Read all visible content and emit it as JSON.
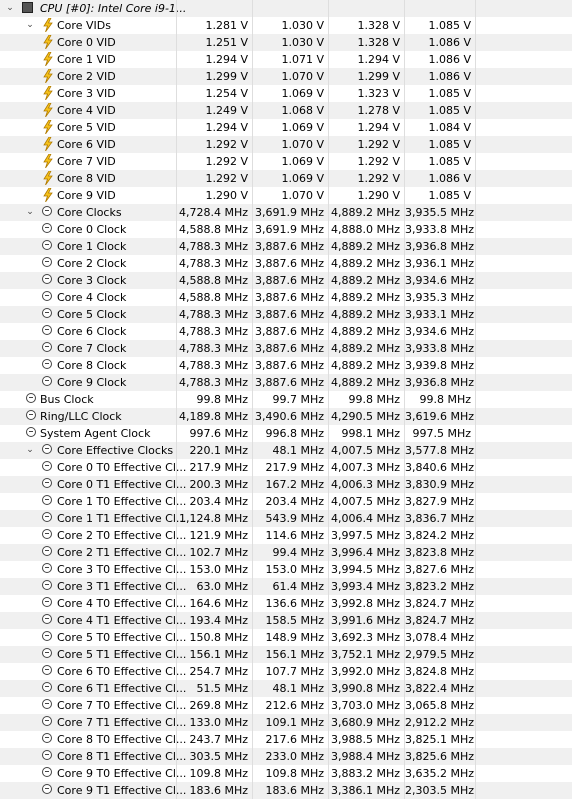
{
  "header": {
    "label": "CPU [#0]: Intel Core i9-1..."
  },
  "rows": [
    {
      "level": 1,
      "expander": "open",
      "icon": "bolt-icon",
      "label": "Core VIDs",
      "values": [
        "1.281 V",
        "1.030 V",
        "1.328 V",
        "1.085 V"
      ]
    },
    {
      "level": 2,
      "icon": "bolt-icon",
      "label": "Core 0 VID",
      "values": [
        "1.251 V",
        "1.030 V",
        "1.328 V",
        "1.086 V"
      ]
    },
    {
      "level": 2,
      "icon": "bolt-icon",
      "label": "Core 1 VID",
      "values": [
        "1.294 V",
        "1.071 V",
        "1.294 V",
        "1.086 V"
      ]
    },
    {
      "level": 2,
      "icon": "bolt-icon",
      "label": "Core 2 VID",
      "values": [
        "1.299 V",
        "1.070 V",
        "1.299 V",
        "1.086 V"
      ]
    },
    {
      "level": 2,
      "icon": "bolt-icon",
      "label": "Core 3 VID",
      "values": [
        "1.254 V",
        "1.069 V",
        "1.323 V",
        "1.085 V"
      ]
    },
    {
      "level": 2,
      "icon": "bolt-icon",
      "label": "Core 4 VID",
      "values": [
        "1.249 V",
        "1.068 V",
        "1.278 V",
        "1.085 V"
      ]
    },
    {
      "level": 2,
      "icon": "bolt-icon",
      "label": "Core 5 VID",
      "values": [
        "1.294 V",
        "1.069 V",
        "1.294 V",
        "1.084 V"
      ]
    },
    {
      "level": 2,
      "icon": "bolt-icon",
      "label": "Core 6 VID",
      "values": [
        "1.292 V",
        "1.070 V",
        "1.292 V",
        "1.085 V"
      ]
    },
    {
      "level": 2,
      "icon": "bolt-icon",
      "label": "Core 7 VID",
      "values": [
        "1.292 V",
        "1.069 V",
        "1.292 V",
        "1.085 V"
      ]
    },
    {
      "level": 2,
      "icon": "bolt-icon",
      "label": "Core 8 VID",
      "values": [
        "1.292 V",
        "1.069 V",
        "1.292 V",
        "1.086 V"
      ]
    },
    {
      "level": 2,
      "icon": "bolt-icon",
      "label": "Core 9 VID",
      "values": [
        "1.290 V",
        "1.070 V",
        "1.290 V",
        "1.085 V"
      ]
    },
    {
      "level": 1,
      "expander": "open",
      "icon": "clock-icon",
      "label": "Core Clocks",
      "values": [
        "4,728.4 MHz",
        "3,691.9 MHz",
        "4,889.2 MHz",
        "3,935.5 MHz"
      ]
    },
    {
      "level": 2,
      "icon": "clock-icon",
      "label": "Core 0 Clock",
      "values": [
        "4,588.8 MHz",
        "3,691.9 MHz",
        "4,888.0 MHz",
        "3,933.8 MHz"
      ]
    },
    {
      "level": 2,
      "icon": "clock-icon",
      "label": "Core 1 Clock",
      "values": [
        "4,788.3 MHz",
        "3,887.6 MHz",
        "4,889.2 MHz",
        "3,936.8 MHz"
      ]
    },
    {
      "level": 2,
      "icon": "clock-icon",
      "label": "Core 2 Clock",
      "values": [
        "4,788.3 MHz",
        "3,887.6 MHz",
        "4,889.2 MHz",
        "3,936.1 MHz"
      ]
    },
    {
      "level": 2,
      "icon": "clock-icon",
      "label": "Core 3 Clock",
      "values": [
        "4,588.8 MHz",
        "3,887.6 MHz",
        "4,889.2 MHz",
        "3,934.6 MHz"
      ]
    },
    {
      "level": 2,
      "icon": "clock-icon",
      "label": "Core 4 Clock",
      "values": [
        "4,588.8 MHz",
        "3,887.6 MHz",
        "4,889.2 MHz",
        "3,935.3 MHz"
      ]
    },
    {
      "level": 2,
      "icon": "clock-icon",
      "label": "Core 5 Clock",
      "values": [
        "4,788.3 MHz",
        "3,887.6 MHz",
        "4,889.2 MHz",
        "3,933.1 MHz"
      ]
    },
    {
      "level": 2,
      "icon": "clock-icon",
      "label": "Core 6 Clock",
      "values": [
        "4,788.3 MHz",
        "3,887.6 MHz",
        "4,889.2 MHz",
        "3,934.6 MHz"
      ]
    },
    {
      "level": 2,
      "icon": "clock-icon",
      "label": "Core 7 Clock",
      "values": [
        "4,788.3 MHz",
        "3,887.6 MHz",
        "4,889.2 MHz",
        "3,933.8 MHz"
      ]
    },
    {
      "level": 2,
      "icon": "clock-icon",
      "label": "Core 8 Clock",
      "values": [
        "4,788.3 MHz",
        "3,887.6 MHz",
        "4,889.2 MHz",
        "3,939.8 MHz"
      ]
    },
    {
      "level": 2,
      "icon": "clock-icon",
      "label": "Core 9 Clock",
      "values": [
        "4,788.3 MHz",
        "3,887.6 MHz",
        "4,889.2 MHz",
        "3,936.8 MHz"
      ]
    },
    {
      "level": 0,
      "icon": "clock-icon",
      "label": "Bus Clock",
      "values": [
        "99.8 MHz",
        "99.7 MHz",
        "99.8 MHz",
        "99.8 MHz"
      ]
    },
    {
      "level": 0,
      "icon": "clock-icon",
      "label": "Ring/LLC Clock",
      "values": [
        "4,189.8 MHz",
        "3,490.6 MHz",
        "4,290.5 MHz",
        "3,619.6 MHz"
      ]
    },
    {
      "level": 0,
      "icon": "clock-icon",
      "label": "System Agent Clock",
      "values": [
        "997.6 MHz",
        "996.8 MHz",
        "998.1 MHz",
        "997.5 MHz"
      ]
    },
    {
      "level": 1,
      "expander": "open",
      "icon": "clock-icon",
      "label": "Core Effective Clocks",
      "values": [
        "220.1 MHz",
        "48.1 MHz",
        "4,007.5 MHz",
        "3,577.8 MHz"
      ]
    },
    {
      "level": 2,
      "icon": "clock-icon",
      "label": "Core 0 T0 Effective Cl...",
      "values": [
        "217.9 MHz",
        "217.9 MHz",
        "4,007.3 MHz",
        "3,840.6 MHz"
      ]
    },
    {
      "level": 2,
      "icon": "clock-icon",
      "label": "Core 0 T1 Effective Cl...",
      "values": [
        "200.3 MHz",
        "167.2 MHz",
        "4,006.3 MHz",
        "3,830.9 MHz"
      ]
    },
    {
      "level": 2,
      "icon": "clock-icon",
      "label": "Core 1 T0 Effective Cl...",
      "values": [
        "203.4 MHz",
        "203.4 MHz",
        "4,007.5 MHz",
        "3,827.9 MHz"
      ]
    },
    {
      "level": 2,
      "icon": "clock-icon",
      "label": "Core 1 T1 Effective Cl...",
      "values": [
        "1,124.8 MHz",
        "543.9 MHz",
        "4,006.4 MHz",
        "3,836.7 MHz"
      ]
    },
    {
      "level": 2,
      "icon": "clock-icon",
      "label": "Core 2 T0 Effective Cl...",
      "values": [
        "121.9 MHz",
        "114.6 MHz",
        "3,997.5 MHz",
        "3,824.2 MHz"
      ]
    },
    {
      "level": 2,
      "icon": "clock-icon",
      "label": "Core 2 T1 Effective Cl...",
      "values": [
        "102.7 MHz",
        "99.4 MHz",
        "3,996.4 MHz",
        "3,823.8 MHz"
      ]
    },
    {
      "level": 2,
      "icon": "clock-icon",
      "label": "Core 3 T0 Effective Cl...",
      "values": [
        "153.0 MHz",
        "153.0 MHz",
        "3,994.5 MHz",
        "3,827.6 MHz"
      ]
    },
    {
      "level": 2,
      "icon": "clock-icon",
      "label": "Core 3 T1 Effective Cl...",
      "values": [
        "63.0 MHz",
        "61.4 MHz",
        "3,993.4 MHz",
        "3,823.2 MHz"
      ]
    },
    {
      "level": 2,
      "icon": "clock-icon",
      "label": "Core 4 T0 Effective Cl...",
      "values": [
        "164.6 MHz",
        "136.6 MHz",
        "3,992.8 MHz",
        "3,824.7 MHz"
      ]
    },
    {
      "level": 2,
      "icon": "clock-icon",
      "label": "Core 4 T1 Effective Cl...",
      "values": [
        "193.4 MHz",
        "158.5 MHz",
        "3,991.6 MHz",
        "3,824.7 MHz"
      ]
    },
    {
      "level": 2,
      "icon": "clock-icon",
      "label": "Core 5 T0 Effective Cl...",
      "values": [
        "150.8 MHz",
        "148.9 MHz",
        "3,692.3 MHz",
        "3,078.4 MHz"
      ]
    },
    {
      "level": 2,
      "icon": "clock-icon",
      "label": "Core 5 T1 Effective Cl...",
      "values": [
        "156.1 MHz",
        "156.1 MHz",
        "3,752.1 MHz",
        "2,979.5 MHz"
      ]
    },
    {
      "level": 2,
      "icon": "clock-icon",
      "label": "Core 6 T0 Effective Cl...",
      "values": [
        "254.7 MHz",
        "107.7 MHz",
        "3,992.0 MHz",
        "3,824.8 MHz"
      ]
    },
    {
      "level": 2,
      "icon": "clock-icon",
      "label": "Core 6 T1 Effective Cl...",
      "values": [
        "51.5 MHz",
        "48.1 MHz",
        "3,990.8 MHz",
        "3,822.4 MHz"
      ]
    },
    {
      "level": 2,
      "icon": "clock-icon",
      "label": "Core 7 T0 Effective Cl...",
      "values": [
        "269.8 MHz",
        "212.6 MHz",
        "3,703.0 MHz",
        "3,065.8 MHz"
      ]
    },
    {
      "level": 2,
      "icon": "clock-icon",
      "label": "Core 7 T1 Effective Cl...",
      "values": [
        "133.0 MHz",
        "109.1 MHz",
        "3,680.9 MHz",
        "2,912.2 MHz"
      ]
    },
    {
      "level": 2,
      "icon": "clock-icon",
      "label": "Core 8 T0 Effective Cl...",
      "values": [
        "243.7 MHz",
        "217.6 MHz",
        "3,988.5 MHz",
        "3,825.1 MHz"
      ]
    },
    {
      "level": 2,
      "icon": "clock-icon",
      "label": "Core 8 T1 Effective Cl...",
      "values": [
        "303.5 MHz",
        "233.0 MHz",
        "3,988.4 MHz",
        "3,825.6 MHz"
      ]
    },
    {
      "level": 2,
      "icon": "clock-icon",
      "label": "Core 9 T0 Effective Cl...",
      "values": [
        "109.8 MHz",
        "109.8 MHz",
        "3,883.2 MHz",
        "3,635.2 MHz"
      ]
    },
    {
      "level": 2,
      "icon": "clock-icon",
      "label": "Core 9 T1 Effective Cl...",
      "values": [
        "183.6 MHz",
        "183.6 MHz",
        "3,386.1 MHz",
        "2,303.5 MHz"
      ]
    }
  ]
}
